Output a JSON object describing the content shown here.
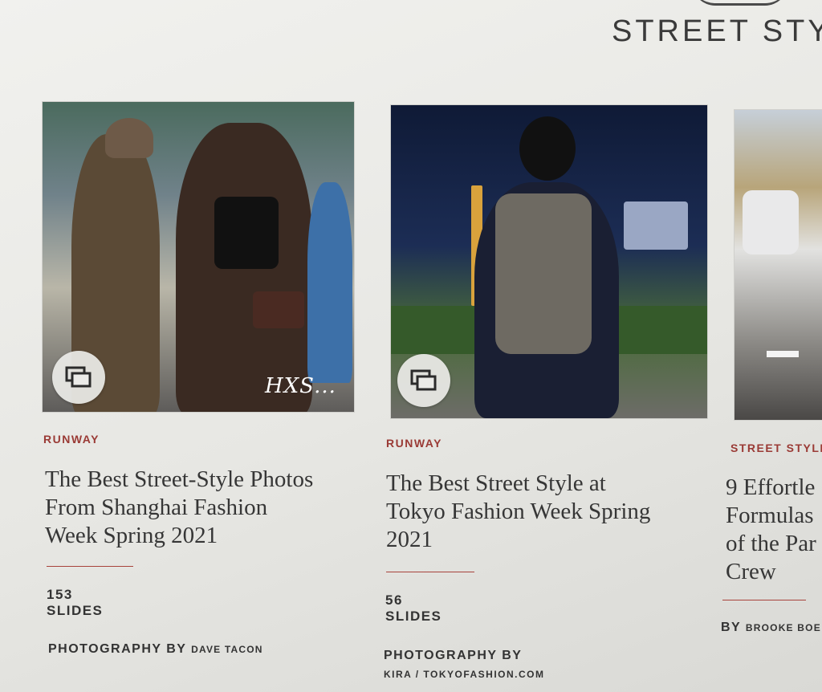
{
  "section": {
    "title": "STREET STYL"
  },
  "cards": [
    {
      "category": "RUNWAY",
      "title": "The Best Street-Style Photos From Shanghai Fashion Week Spring 2021",
      "title_lines": [
        "The Best Street-Style Photos",
        "From Shanghai Fashion",
        "Week Spring 2021"
      ],
      "slides": "153 SLIDES",
      "credit_label": "PHOTOGRAPHY BY",
      "credit_name": "DAVE TACON",
      "watermark": "HXS..."
    },
    {
      "category": "RUNWAY",
      "title": "The Best Street Style at Tokyo Fashion Week Spring 2021",
      "title_lines": [
        "The Best Street Style at",
        "Tokyo Fashion Week Spring",
        "2021"
      ],
      "slides": "56 SLIDES",
      "credit_label": "PHOTOGRAPHY BY",
      "credit_name": "KIRA / TOKYOFASHION.COM"
    },
    {
      "category": "STREET STYLE",
      "title_lines": [
        "9 Effortle",
        "Formulas",
        "of the Par",
        "Crew"
      ],
      "credit_label": "BY",
      "credit_name": "BROOKE BOE"
    }
  ],
  "icons": {
    "gallery": "gallery-stack-icon"
  },
  "colors": {
    "category": "#9a3a35",
    "background": "#e9e9e6",
    "text": "#363636"
  }
}
